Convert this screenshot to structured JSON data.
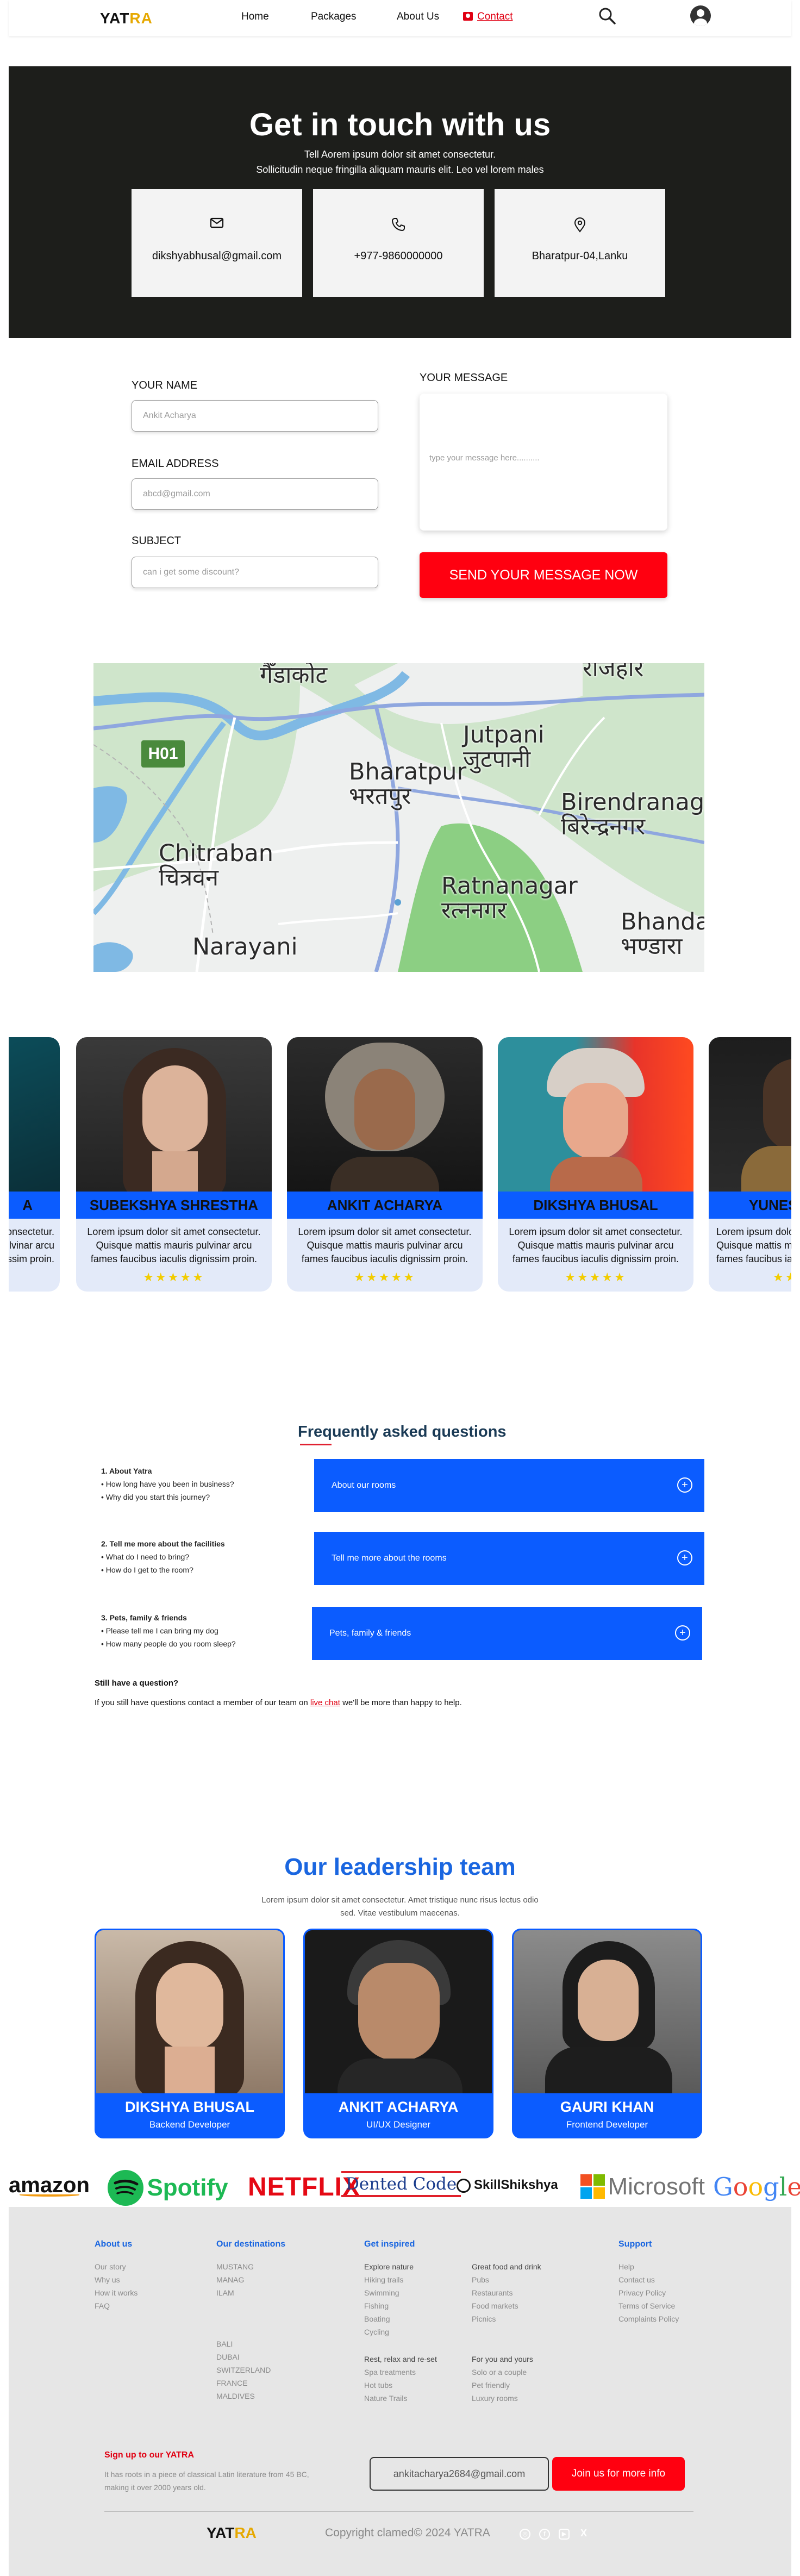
{
  "nav": {
    "logo_a": "YAT",
    "logo_b": "RA",
    "links": [
      "Home",
      "Packages",
      "About Us"
    ],
    "contact": "Contact"
  },
  "hero": {
    "title": "Get in touch with us",
    "sub1": "Tell Aorem ipsum dolor sit amet consectetur.",
    "sub2": "Sollicitudin neque fringilla aliquam mauris elit. Leo vel lorem males",
    "cards": [
      {
        "icon": "mail-icon",
        "text": "dikshyabhusal@gmail.com"
      },
      {
        "icon": "phone-icon",
        "text": "+977-9860000000"
      },
      {
        "icon": "location-icon",
        "text": "Bharatpur-04,Lanku"
      }
    ]
  },
  "form": {
    "name_label": "YOUR NAME",
    "name_placeholder": "Ankit Acharya",
    "email_label": "EMAIL ADDRESS",
    "email_placeholder": "abcd@gmail.com",
    "subject_label": "SUBJECT",
    "subject_placeholder": "can i get some discount?",
    "message_label": "YOUR MESSAGE",
    "message_placeholder": "type your message here..........",
    "send": "SEND YOUR MESSAGE NOW"
  },
  "map": {
    "labels": {
      "gandakot": "गैँडाकोट",
      "rajahar": "राजहार",
      "bharatpur": "Bharatpur",
      "bharatpur_dev": "भरतपुर",
      "jutpani": "Jutpani",
      "jutpani_dev": "जुटपानी",
      "birendranagar": "Birendranagar",
      "birendranagar_dev": "बिरेन्द्रनगर",
      "chitraban": "Chitraban",
      "chitraban_dev": "चित्रवन",
      "ratnanagar": "Ratnanagar",
      "ratnanagar_dev": "रत्ननगर",
      "bhandara": "Bhandar",
      "bhandara_dev": "भण्डारा",
      "narayani": "Narayani",
      "highway": "H01"
    }
  },
  "people": [
    {
      "name": "A",
      "desc": "Lorem ipsum dolor sit amet consectetur. Quisque mattis mauris pulvinar arcu fames faucibus iaculis dignissim proin.",
      "stars": "★★★★★"
    },
    {
      "name": "SUBEKSHYA SHRESTHA",
      "desc": "Lorem ipsum dolor sit amet consectetur. Quisque mattis mauris pulvinar arcu fames faucibus iaculis dignissim proin.",
      "stars": "★★★★★"
    },
    {
      "name": "ANKIT ACHARYA",
      "desc": "Lorem ipsum dolor sit amet consectetur. Quisque mattis mauris pulvinar arcu fames faucibus iaculis dignissim proin.",
      "stars": "★★★★★"
    },
    {
      "name": "DIKSHYA BHUSAL",
      "desc": "Lorem ipsum dolor sit amet consectetur. Quisque mattis mauris pulvinar arcu fames faucibus iaculis dignissim proin.",
      "stars": "★★★★★"
    },
    {
      "name": "YUNES",
      "desc": "Lorem ipsum dolor sit amet consectetur. Quisque mattis mauris pulvinar arcu fames faucibus iaculis dignissim proin.",
      "stars": "★★★★★"
    }
  ],
  "faq": {
    "title": "Frequently asked questions",
    "groups": [
      {
        "heading": "1. About Yatra",
        "items": [
          "• How long have you been in business?",
          "• Why did you start this journey?"
        ],
        "bar": "About our rooms"
      },
      {
        "heading": "2. Tell me more about the facilities",
        "items": [
          "• What do I need to bring?",
          "• How do I get to the room?"
        ],
        "bar": "Tell me more about the rooms"
      },
      {
        "heading": "3. Pets, family & friends",
        "items": [
          "• Please tell me I can bring my dog",
          "• How many people do you room sleep?"
        ],
        "bar": "Pets, family & friends"
      }
    ],
    "still": "Still have a question?",
    "help_a": "If you still have questions contact a member of our team on ",
    "help_link": "live chat",
    "help_b": " we'll be more than happy to help."
  },
  "leadership": {
    "title": "Our leadership team",
    "sub": "Lorem ipsum dolor sit amet consectetur. Amet tristique nunc risus lectus odio sed. Vitae vestibulum maecenas.",
    "members": [
      {
        "name": "DIKSHYA BHUSAL",
        "role": "Backend Developer"
      },
      {
        "name": "ANKIT ACHARYA",
        "role": "UI/UX Designer"
      },
      {
        "name": "GAURI KHAN",
        "role": "Frontend Developer"
      }
    ]
  },
  "brands": [
    "amazon",
    "Spotify",
    "NETFLIX",
    "Dented Code",
    "SkillShikshya",
    "Microsoft",
    "Google"
  ],
  "footer": {
    "about": {
      "heading": "About us",
      "items": [
        "Our story",
        "Why us",
        "How it works",
        "FAQ"
      ]
    },
    "destinations": {
      "heading": "Our destinations",
      "items": [
        "MUSTANG",
        "MANAG",
        "ILAM",
        "BALI",
        "DUBAI",
        "SWITZERLAND",
        "FRANCE",
        "MALDIVES"
      ]
    },
    "inspired": {
      "heading": "Get inspired",
      "explore_heading": "Explore nature",
      "explore": [
        "Hiking trails",
        "Swimming",
        "Fishing",
        "Boating",
        "Cycling"
      ],
      "food_heading": "Great food and drink",
      "food": [
        "Pubs",
        "Restaurants",
        "Food markets",
        "Picnics"
      ],
      "relax_heading": "Rest, relax and re-set",
      "relax": [
        "Spa treatments",
        "Hot tubs",
        "Nature Trails"
      ],
      "foryou_heading": "For you and yours",
      "foryou": [
        "Solo or a couple",
        "Pet friendly",
        "Luxury rooms"
      ]
    },
    "support": {
      "heading": "Support",
      "items": [
        "Help",
        "Contact us",
        "Privacy Policy",
        "Terms of Service",
        "Complaints Policy"
      ]
    },
    "signup_heading": "Sign up to our YATRA",
    "signup_text": "It has roots in a piece of classical Latin literature from 45 BC, making it over 2000 years old.",
    "signup_email": "ankitacharya2684@gmail.com",
    "signup_button": "Join us for more info",
    "copyright": "Copyright clamed© 2024 YATRA"
  }
}
